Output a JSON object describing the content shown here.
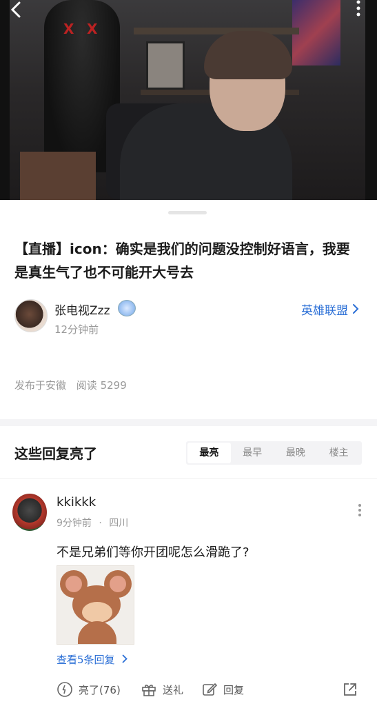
{
  "video": {
    "back_icon": "chevron-left-icon",
    "more_icon": "more-vertical-icon"
  },
  "post": {
    "title": "【直播】icon：确实是我们的问题没控制好语言，我要是真生气了也不可能开大号去",
    "author": {
      "name": "张电视Zzz",
      "time": "12分钟前"
    },
    "board": {
      "label": "英雄联盟"
    },
    "meta": {
      "published": "发布于安徽",
      "reads": "阅读 5299"
    }
  },
  "replies": {
    "heading": "这些回复亮了",
    "sort_tabs": [
      {
        "label": "最亮",
        "active": true
      },
      {
        "label": "最早",
        "active": false
      },
      {
        "label": "最晚",
        "active": false
      },
      {
        "label": "楼主",
        "active": false
      }
    ],
    "comment": {
      "user": "kkikkk",
      "time": "9分钟前",
      "separator": "·",
      "location": "四川",
      "text": "不是兄弟们等你开团呢怎么滑跪了?",
      "view_replies": "查看5条回复",
      "actions": {
        "like": "亮了(76)",
        "gift": "送礼",
        "reply": "回复"
      }
    }
  },
  "colors": {
    "link_blue": "#2b6fd6",
    "muted_gray": "#999999",
    "divider": "#f4f4f6"
  }
}
